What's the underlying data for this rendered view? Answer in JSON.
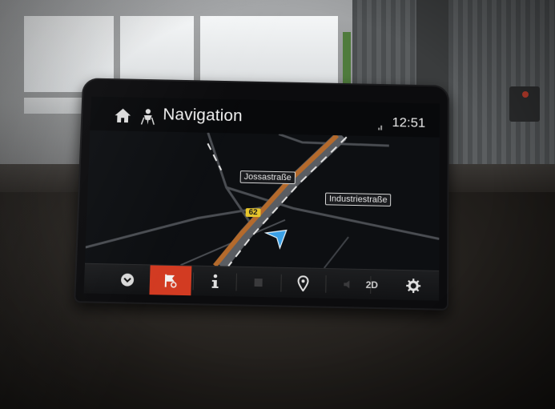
{
  "header": {
    "title": "Navigation",
    "time": "12:51"
  },
  "map": {
    "street_labels": [
      "Jossastraße",
      "Industriestraße"
    ],
    "road_badge": "62"
  },
  "toolbar": {
    "view_mode_label": "2D"
  },
  "icons": {
    "home": "home-icon",
    "navigation": "nav-person-icon",
    "position": "position-arrow-icon"
  },
  "colors": {
    "active_button": "#d23b22",
    "road_badge": "#e8c62b",
    "route": "#b46a2c",
    "position_marker": "#3aa0e6"
  }
}
